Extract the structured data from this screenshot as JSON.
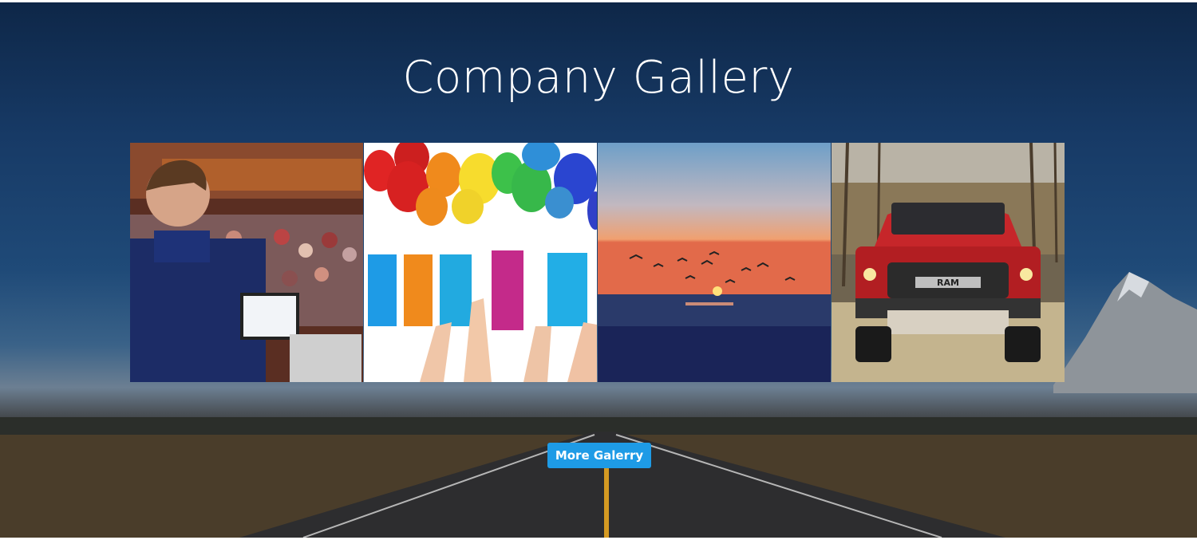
{
  "gallery": {
    "title": "Company Gallery",
    "images": [
      {
        "name": "conference-speaker"
      },
      {
        "name": "balloons-event"
      },
      {
        "name": "sunset-beach-birds"
      },
      {
        "name": "red-pickup-truck",
        "badge_text": "RAM"
      }
    ],
    "more_button_label": "More Galerry"
  },
  "colors": {
    "button": "#1e9be6",
    "title": "#ffffff",
    "sky_top": "#0e2748"
  }
}
